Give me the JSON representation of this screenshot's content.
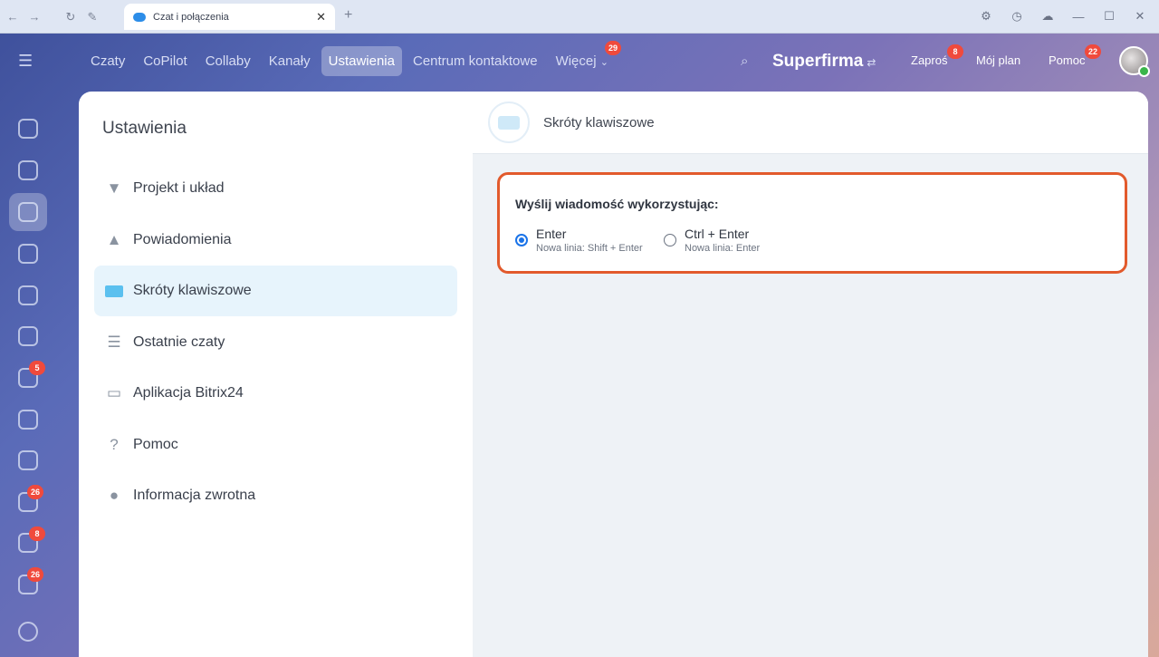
{
  "browser": {
    "tab_title": "Czat i połączenia",
    "tab_close": "✕",
    "new_tab": "+"
  },
  "topbar": {
    "menu": [
      {
        "label": "Czaty",
        "active": false
      },
      {
        "label": "CoPilot",
        "active": false
      },
      {
        "label": "Collaby",
        "active": false
      },
      {
        "label": "Kanały",
        "active": false
      },
      {
        "label": "Ustawienia",
        "active": true
      },
      {
        "label": "Centrum kontaktowe",
        "active": false
      },
      {
        "label": "Więcej",
        "active": false,
        "badge": "29"
      }
    ],
    "brand": "Superfirma",
    "brand_switch": "⇄",
    "invite": "Zaproś",
    "invite_badge": "8",
    "plan": "Mój plan",
    "help": "Pomoc",
    "help_badge": "22"
  },
  "rail": {
    "badges": [
      "5",
      "26",
      "8",
      "26"
    ]
  },
  "settings": {
    "heading": "Ustawienia",
    "items": [
      {
        "label": "Projekt i układ",
        "icon": "brush-icon",
        "active": false
      },
      {
        "label": "Powiadomienia",
        "icon": "bell-icon",
        "active": false
      },
      {
        "label": "Skróty klawiszowe",
        "icon": "keyboard-icon",
        "active": true
      },
      {
        "label": "Ostatnie czaty",
        "icon": "list-icon",
        "active": false
      },
      {
        "label": "Aplikacja Bitrix24",
        "icon": "monitor-icon",
        "active": false
      },
      {
        "label": "Pomoc",
        "icon": "question-icon",
        "active": false
      },
      {
        "label": "Informacja zwrotna",
        "icon": "chat-bubble-icon",
        "active": false
      }
    ]
  },
  "content": {
    "title": "Skróty klawiszowe",
    "send_label": "Wyślij wiadomość wykorzystując:",
    "options": [
      {
        "label": "Enter",
        "sub": "Nowa linia: Shift + Enter",
        "selected": true
      },
      {
        "label": "Ctrl + Enter",
        "sub": "Nowa linia: Enter",
        "selected": false
      }
    ]
  },
  "colors": {
    "accent": "#1a73e8",
    "highlight_border": "#e25a2c",
    "badge": "#f04a3c",
    "active_item_bg": "#e7f4fc"
  }
}
